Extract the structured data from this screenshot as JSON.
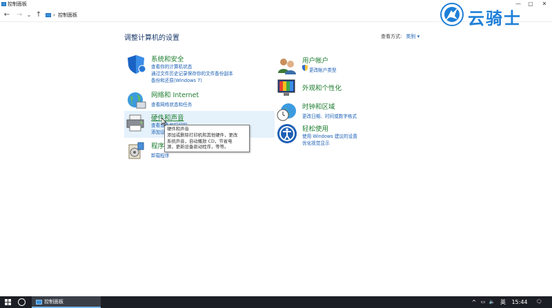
{
  "window": {
    "title": "控制面板",
    "minimize": "—",
    "maximize": "▢",
    "close": "✕"
  },
  "nav": {
    "back": "←",
    "forward": "→",
    "recent": "⌄",
    "up": "↑"
  },
  "breadcrumb": {
    "separator": "›",
    "item": "控制面板"
  },
  "watermark": "云骑士",
  "page": {
    "title": "调整计算机的设置",
    "viewby_label": "查看方式:",
    "viewby_value": "类别 ▾"
  },
  "categories": [
    {
      "title": "系统和安全",
      "links": [
        "查看你的计算机状态",
        "通过文件历史记录保存你的文件备份副本",
        "备份和还原(Windows 7)"
      ]
    },
    {
      "title": "网络和 Internet",
      "links": [
        "查看网络状态和任务"
      ]
    },
    {
      "title": "硬件和声音",
      "links": [
        "查看设备和打印机",
        "添加设备"
      ]
    },
    {
      "title": "程序",
      "links": [
        "卸载程序"
      ]
    },
    {
      "title": "用户帐户",
      "links": [
        "更改帐户类型"
      ]
    },
    {
      "title": "外观和个性化",
      "links": []
    },
    {
      "title": "时钟和区域",
      "links": [
        "更改日期、时间或数字格式"
      ]
    },
    {
      "title": "轻松使用",
      "links": [
        "使用 Windows 建议的设置",
        "优化视觉显示"
      ]
    }
  ],
  "tooltip": {
    "lines": [
      "硬件和声音",
      "添加或删除打印机和其他硬件，更改",
      "系统声音，自动播放 CD，节省电",
      "源，更新设备驱动程序，等等。"
    ]
  },
  "taskbar": {
    "app_label": "控制面板",
    "tray": {
      "chevron": "^",
      "network": "▭",
      "volume": "🔈",
      "ime": "英",
      "time": "15:44",
      "notify": "🗨"
    }
  },
  "colors": {
    "accent": "#1a5fb4",
    "category_title": "#1d7d2f",
    "hover_bg": "#e5f1fb",
    "taskbar": "#1b1e24",
    "watermark": "#1e7fd8"
  }
}
